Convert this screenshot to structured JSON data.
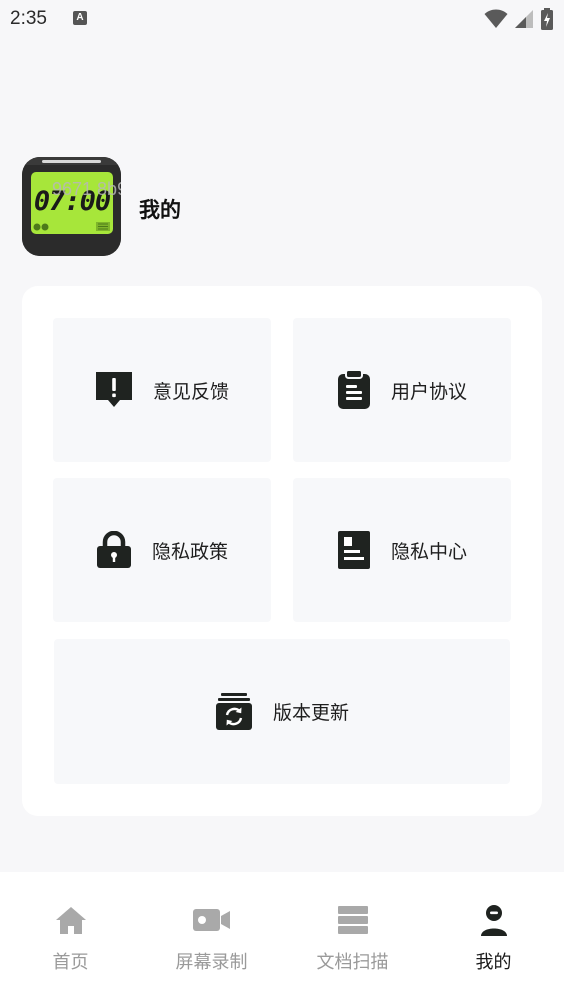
{
  "status_bar": {
    "time": "2:35",
    "notification_icon": "font-a-icon",
    "icons": [
      "wifi-icon",
      "signal-icon",
      "battery-charging-icon"
    ]
  },
  "profile": {
    "logo_time": "07:00",
    "logo_watermark": "9671 8b99",
    "name": "我的"
  },
  "menu": {
    "feedback": {
      "label": "意见反馈",
      "icon": "feedback-icon"
    },
    "user_agreement": {
      "label": "用户协议",
      "icon": "clipboard-icon"
    },
    "privacy_policy": {
      "label": "隐私政策",
      "icon": "lock-icon"
    },
    "privacy_center": {
      "label": "隐私中心",
      "icon": "id-card-icon"
    },
    "version_update": {
      "label": "版本更新",
      "icon": "refresh-icon"
    }
  },
  "bottom_nav": {
    "items": [
      {
        "label": "首页",
        "icon": "home-icon",
        "active": false
      },
      {
        "label": "屏幕录制",
        "icon": "video-camera-icon",
        "active": false
      },
      {
        "label": "文档扫描",
        "icon": "document-stack-icon",
        "active": false
      },
      {
        "label": "我的",
        "icon": "user-icon",
        "active": true
      }
    ]
  },
  "colors": {
    "background": "#f7f7f9",
    "card": "#ffffff",
    "tile": "#f7f8fa",
    "icon_dark": "#1f2320",
    "nav_inactive": "#9a9a9a",
    "nav_active": "#1a1a1a",
    "logo_green": "#a7e63a"
  }
}
